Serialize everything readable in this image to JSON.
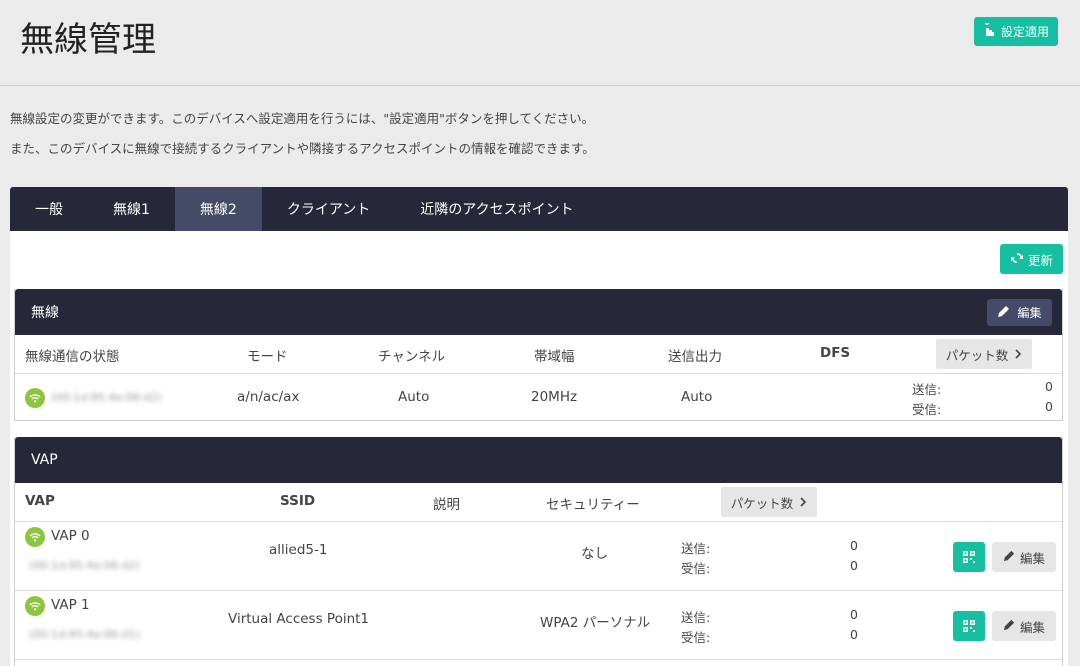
{
  "page": {
    "title": "無線管理",
    "apply_label": "設定適用",
    "desc1": "無線設定の変更ができます。このデバイスへ設定適用を行うには、\"設定適用\"ボタンを押してください。",
    "desc2": "また、このデバイスに無線で接続するクライアントや隣接するアクセスポイントの情報を確認できます。"
  },
  "tabs": [
    {
      "label": "一般"
    },
    {
      "label": "無線1"
    },
    {
      "label": "無線2",
      "active": true
    },
    {
      "label": "クライアント"
    },
    {
      "label": "近隣のアクセスポイント"
    }
  ],
  "refresh_label": "更新",
  "radio": {
    "title": "無線",
    "edit_label": "編集",
    "headers": {
      "status": "無線通信の状態",
      "mode": "モード",
      "channel": "チャンネル",
      "bandwidth": "帯域幅",
      "power": "送信出力",
      "dfs": "DFS",
      "packets": "パケット数"
    },
    "row": {
      "mac": "(00:1d:95:4e:06:d2)",
      "mode": "a/n/ac/ax",
      "channel": "Auto",
      "bandwidth": "20MHz",
      "power": "Auto",
      "tx_label": "送信:",
      "tx_value": "0",
      "rx_label": "受信:",
      "rx_value": "0"
    }
  },
  "vap": {
    "title": "VAP",
    "headers": {
      "vap": "VAP",
      "ssid": "SSID",
      "desc": "説明",
      "security": "セキュリティー",
      "packets": "パケット数"
    },
    "rows": [
      {
        "name": "VAP 0",
        "mac": "(00:1d:95:4e:06:d2)",
        "ssid": "allied5-1",
        "security": "なし",
        "tx_label": "送信:",
        "tx_value": "0",
        "rx_label": "受信:",
        "rx_value": "0",
        "edit_label": "編集"
      },
      {
        "name": "VAP 1",
        "mac": "(00:1d:95:4e:06:d1)",
        "ssid": "Virtual Access Point1",
        "security": "WPA2 パーソナル",
        "tx_label": "送信:",
        "tx_value": "0",
        "rx_label": "受信:",
        "rx_value": "0",
        "edit_label": "編集"
      }
    ]
  },
  "colors": {
    "accent": "#17bfa2",
    "dark_header": "#262839",
    "active_tab": "#454a67",
    "wifi_green": "#8cc63f"
  }
}
